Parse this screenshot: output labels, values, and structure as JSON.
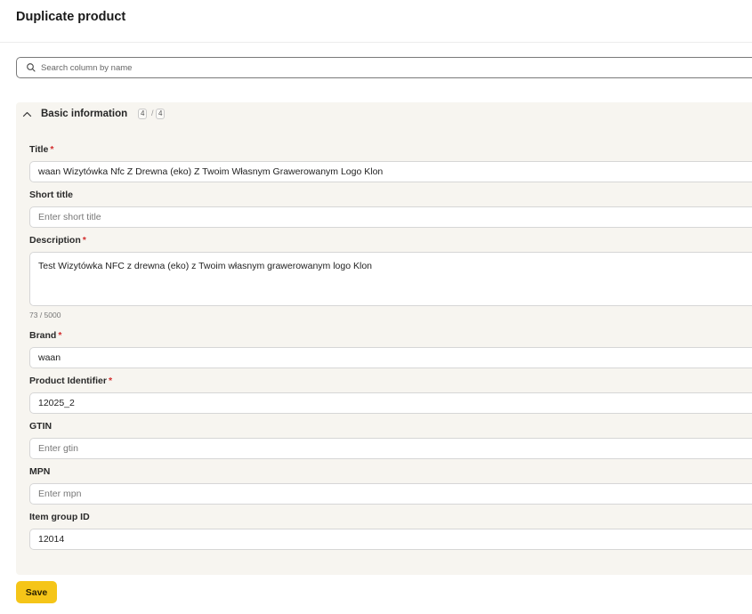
{
  "header": {
    "title": "Duplicate product"
  },
  "search": {
    "placeholder": "Search column by name",
    "value": ""
  },
  "section": {
    "title": "Basic information",
    "count_filled": "4",
    "count_total": "4",
    "expanded": true
  },
  "fields": {
    "title": {
      "label": "Title",
      "required": "*",
      "value": "waan Wizytówka Nfc Z Drewna (eko) Z Twoim Własnym Grawerowanym Logo Klon",
      "placeholder": ""
    },
    "short_title": {
      "label": "Short title",
      "value": "",
      "placeholder": "Enter short title"
    },
    "description": {
      "label": "Description",
      "required": "*",
      "value": "Test Wizytówka NFC z drewna (eko) z Twoim własnym grawerowanym logo Klon",
      "counter": "73 / 5000"
    },
    "brand": {
      "label": "Brand",
      "required": "*",
      "value": "waan"
    },
    "product_identifier": {
      "label": "Product Identifier",
      "required": "*",
      "value": "12025_2"
    },
    "gtin": {
      "label": "GTIN",
      "value": "",
      "placeholder": "Enter gtin"
    },
    "mpn": {
      "label": "MPN",
      "value": "",
      "placeholder": "Enter mpn"
    },
    "item_group_id": {
      "label": "Item group ID",
      "value": "12014"
    }
  },
  "footer": {
    "save_label": "Save"
  },
  "icons": {
    "search": "search-icon",
    "chevron": "chevron-up-icon"
  },
  "colors": {
    "accent": "#f5c518",
    "required": "#d32f2f",
    "panel_bg": "#f7f5f0"
  }
}
